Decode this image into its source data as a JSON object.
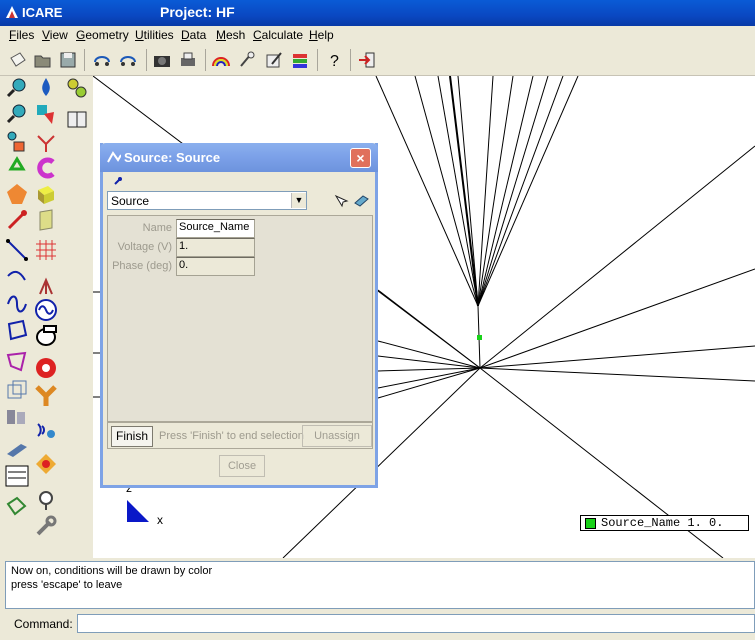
{
  "window": {
    "app_name": "ICARE",
    "project_title": "Project: HF"
  },
  "menu": [
    "Files",
    "View",
    "Geometry",
    "Utilities",
    "Data",
    "Mesh",
    "Calculate",
    "Help"
  ],
  "toolbar_icons": [
    "new-icon",
    "open-icon",
    "save-icon",
    "rotate-icon",
    "rotate2-icon",
    "camera-icon",
    "print-icon",
    "rainbow-icon",
    "wand-icon",
    "edit-icon",
    "layers-icon",
    "help-icon",
    "exit-icon"
  ],
  "dialog": {
    "title": "Source: Source",
    "combo_value": "Source",
    "fields": [
      {
        "label": "Name",
        "value": "Source_Name"
      },
      {
        "label": "Voltage (V)",
        "value": "1."
      },
      {
        "label": "Phase (deg)",
        "value": "0."
      }
    ],
    "finish_label": "Finish",
    "finish_hint": "Press 'Finish' to end selection",
    "unassign_label": "Unassign",
    "close_label": "Close"
  },
  "axes": {
    "z_label": "z",
    "x_label": "x"
  },
  "legend": {
    "text": "Source_Name 1. 0.",
    "color": "#19d219"
  },
  "messages": [
    "Now on, conditions will be drawn by color",
    "press 'escape' to leave"
  ],
  "command": {
    "label": "Command:",
    "value": ""
  }
}
